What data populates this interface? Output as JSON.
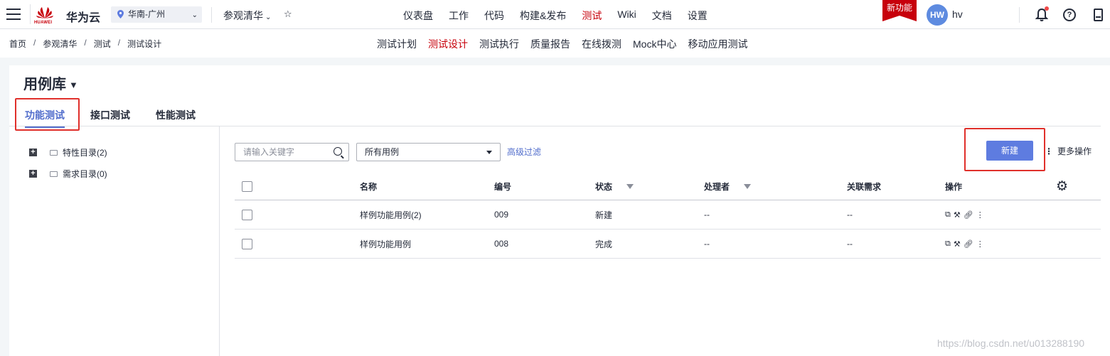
{
  "topbar": {
    "logo_text": "HUAWEI",
    "brand": "华为云",
    "region": "华南-广州",
    "project": "参观清华",
    "nav": [
      "仪表盘",
      "工作",
      "代码",
      "构建&发布",
      "测试",
      "Wiki",
      "文档",
      "设置"
    ],
    "nav_active": "测试",
    "new_feature_badge": "新功能",
    "avatar_initials": "HW",
    "username": "hv"
  },
  "breadcrumb": [
    "首页",
    "参观清华",
    "测试",
    "测试设计"
  ],
  "subnav": [
    "测试计划",
    "测试设计",
    "测试执行",
    "质量报告",
    "在线拨测",
    "Mock中心",
    "移动应用测试"
  ],
  "subnav_active": "测试设计",
  "page": {
    "title": "用例库",
    "tabs": [
      "功能测试",
      "接口测试",
      "性能测试"
    ],
    "active_tab": "功能测试"
  },
  "tree": [
    {
      "label": "特性目录(2)"
    },
    {
      "label": "需求目录(0)"
    }
  ],
  "toolbar": {
    "search_placeholder": "请输入关键字",
    "filter_select": "所有用例",
    "advanced_filter": "高级过滤",
    "new_button": "新建",
    "more_ops": "更多操作"
  },
  "table": {
    "headers": {
      "name": "名称",
      "id": "编号",
      "status": "状态",
      "handler": "处理者",
      "related": "关联需求",
      "actions": "操作"
    },
    "rows": [
      {
        "name": "样例功能用例(2)",
        "id": "009",
        "status": "新建",
        "handler": "--",
        "related": "--"
      },
      {
        "name": "样例功能用例",
        "id": "008",
        "status": "完成",
        "handler": "--",
        "related": "--"
      }
    ]
  },
  "watermark": "https://blog.csdn.net/u013288190",
  "colors": {
    "brand_red": "#c7000b",
    "primary": "#5e7ce0",
    "link": "#526ecc",
    "highlight_box": "#e0302b"
  }
}
